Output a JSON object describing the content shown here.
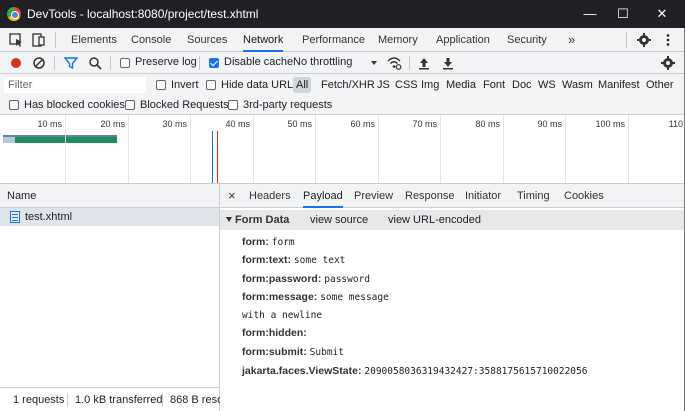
{
  "window": {
    "title": "DevTools - localhost:8080/project/test.xhtml",
    "controls": {
      "minimize": "—",
      "maximize": "☐",
      "close": "✕"
    }
  },
  "main_tabs": [
    {
      "label": "Elements"
    },
    {
      "label": "Console"
    },
    {
      "label": "Sources"
    },
    {
      "label": "Network",
      "active": true
    },
    {
      "label": "Performance"
    },
    {
      "label": "Memory"
    },
    {
      "label": "Application"
    },
    {
      "label": "Security"
    }
  ],
  "more_tabs": "»",
  "toolbar": {
    "preserve_log": {
      "label": "Preserve log",
      "checked": false
    },
    "disable_cache": {
      "label": "Disable cache",
      "checked": true
    },
    "throttling": "No throttling"
  },
  "filter": {
    "placeholder": "Filter",
    "invert": {
      "label": "Invert",
      "checked": false
    },
    "hide_data_urls": {
      "label": "Hide data URLs",
      "checked": false
    },
    "types": [
      {
        "label": "All",
        "active": true
      },
      {
        "label": "Fetch/XHR"
      },
      {
        "label": "JS"
      },
      {
        "label": "CSS"
      },
      {
        "label": "Img"
      },
      {
        "label": "Media"
      },
      {
        "label": "Font"
      },
      {
        "label": "Doc"
      },
      {
        "label": "WS"
      },
      {
        "label": "Wasm"
      },
      {
        "label": "Manifest"
      },
      {
        "label": "Other"
      }
    ],
    "has_blocked_cookies": {
      "label": "Has blocked cookies",
      "checked": false
    },
    "blocked_requests": {
      "label": "Blocked Requests",
      "checked": false
    },
    "third_party": {
      "label": "3rd-party requests",
      "checked": false
    }
  },
  "overview": {
    "ticks": [
      "10 ms",
      "20 ms",
      "30 ms",
      "40 ms",
      "50 ms",
      "60 ms",
      "70 ms",
      "80 ms",
      "90 ms",
      "100 ms",
      "110"
    ],
    "colors": {
      "request": "#1d8e5a",
      "waiting": "#5f7fa8",
      "dom_loaded": "#1a73e8",
      "load": "#d93025"
    }
  },
  "requests": {
    "column_name": "Name",
    "rows": [
      {
        "name": "test.xhtml"
      }
    ]
  },
  "status": {
    "requests": "1 requests",
    "transferred": "1.0 kB transferred",
    "resources": "868 B reso"
  },
  "detail": {
    "close": "×",
    "tabs": [
      {
        "label": "Headers"
      },
      {
        "label": "Payload",
        "active": true
      },
      {
        "label": "Preview"
      },
      {
        "label": "Response"
      },
      {
        "label": "Initiator"
      },
      {
        "label": "Timing"
      },
      {
        "label": "Cookies"
      }
    ],
    "section": {
      "title": "Form Data",
      "view_source": "view source",
      "view_url_encoded": "view URL-encoded"
    },
    "form_data": [
      {
        "key": "form:",
        "value": "form"
      },
      {
        "key": "form:text:",
        "value": "some text"
      },
      {
        "key": "form:password:",
        "value": "password"
      },
      {
        "key": "form:message:",
        "value": "some message"
      },
      {
        "key": "",
        "value": "with a newline"
      },
      {
        "key": "form:hidden:",
        "value": ""
      },
      {
        "key": "form:submit:",
        "value": "Submit"
      },
      {
        "key": "jakarta.faces.ViewState:",
        "value": "2090058036319432427:3588175615710022056"
      }
    ]
  }
}
